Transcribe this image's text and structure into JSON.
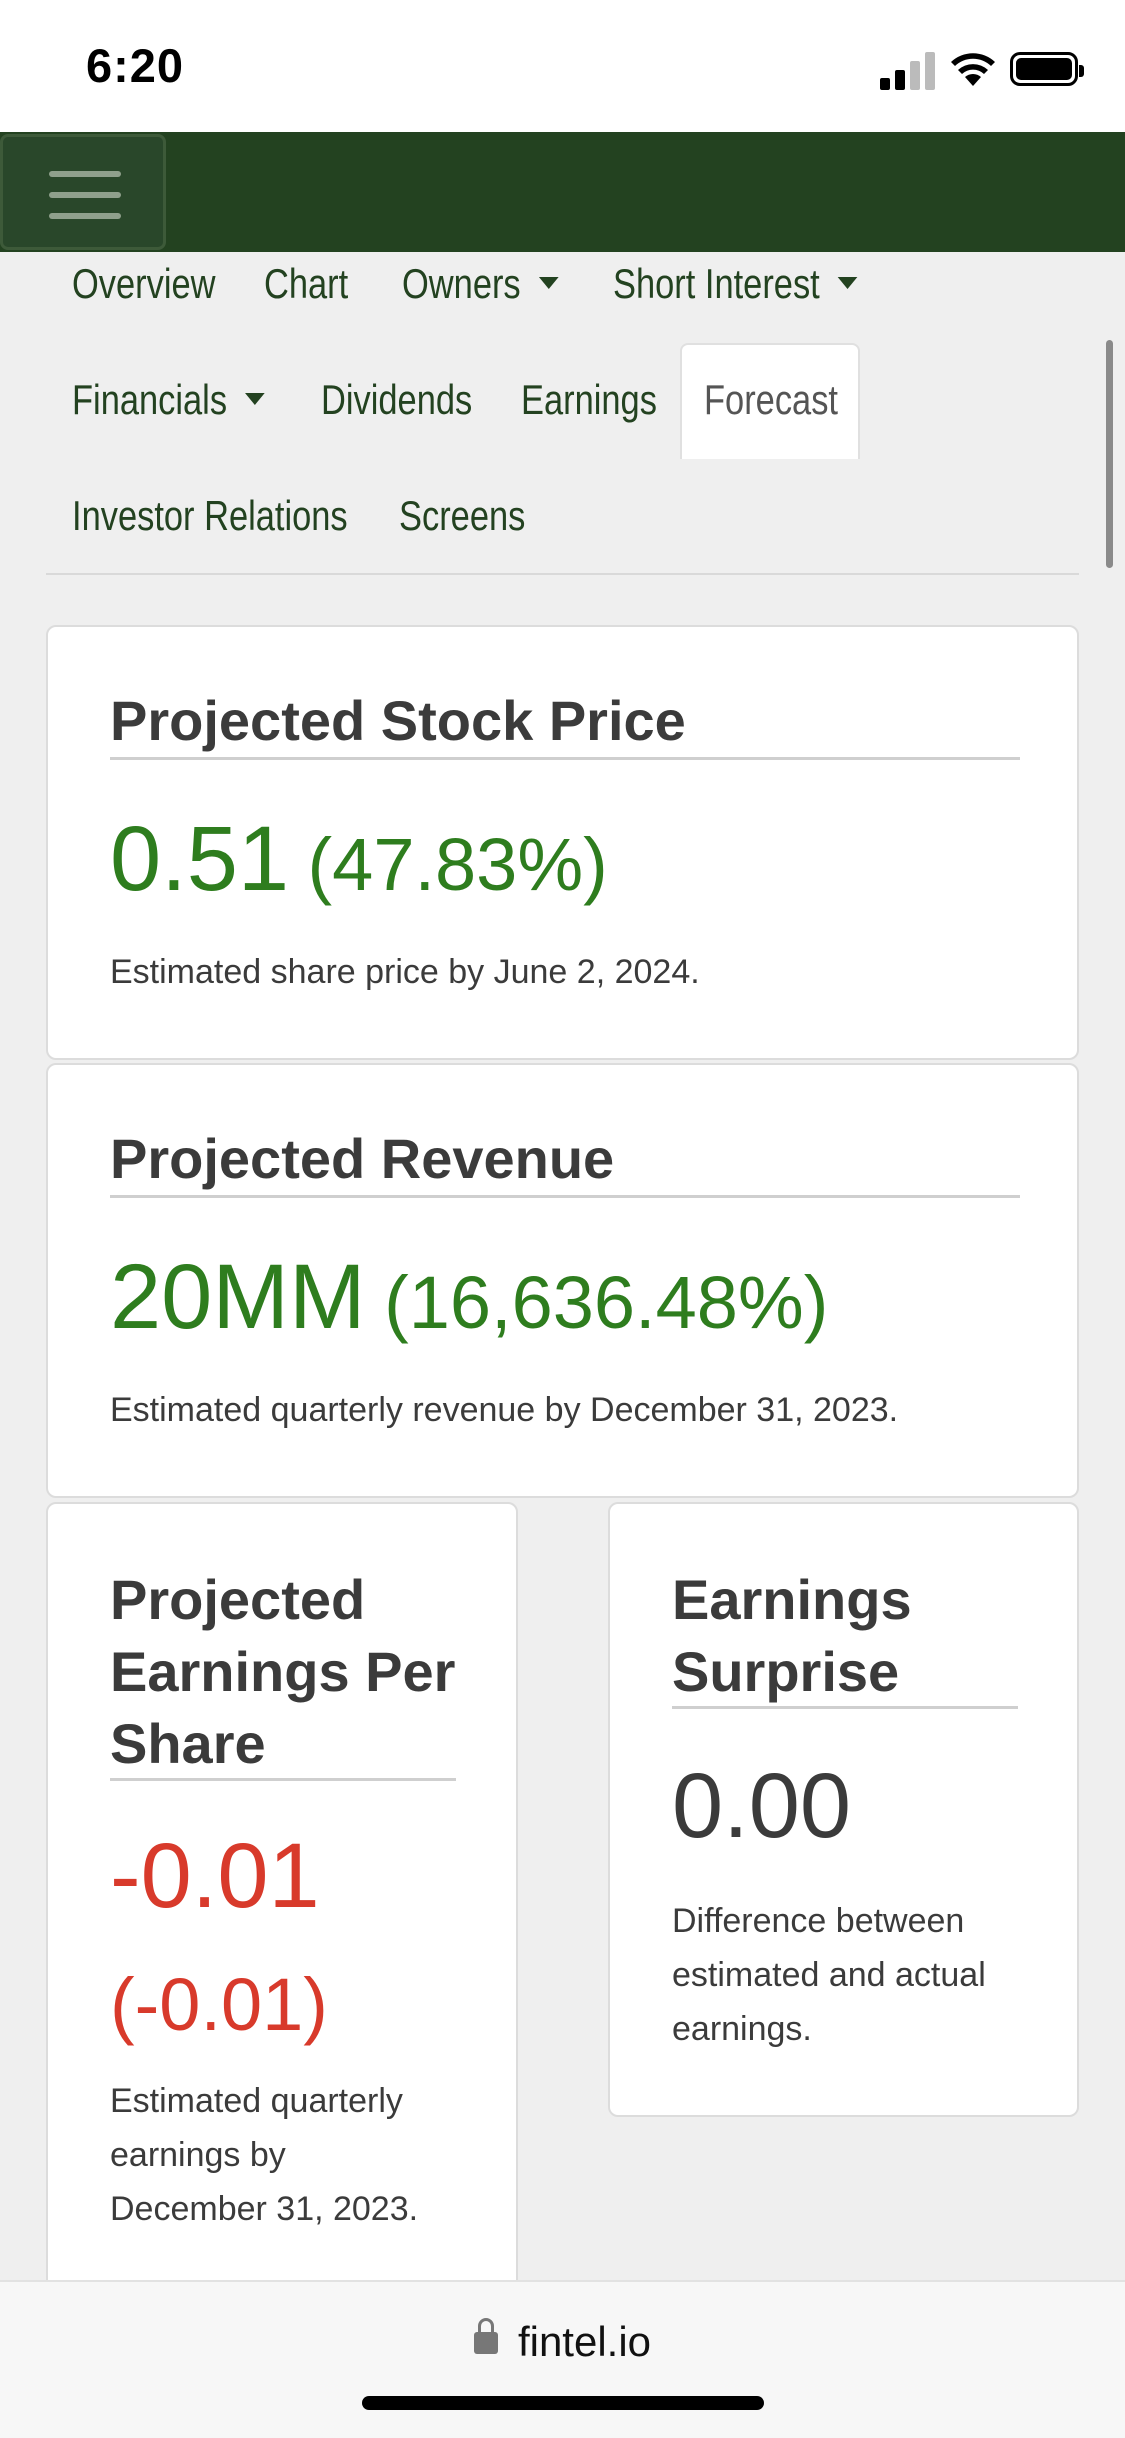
{
  "status_bar": {
    "time": "6:20"
  },
  "nav": {
    "overview": "Overview",
    "chart": "Chart",
    "owners": "Owners",
    "short_interest": "Short Interest",
    "financials": "Financials",
    "dividends": "Dividends",
    "earnings": "Earnings",
    "forecast": "Forecast",
    "investor_relations": "Investor Relations",
    "screens": "Screens",
    "active_tab": "Forecast"
  },
  "cards": {
    "stock_price": {
      "title": "Projected Stock Price",
      "value": "0.51",
      "change": "(47.83%)",
      "description": "Estimated share price by June 2, 2024."
    },
    "revenue": {
      "title": "Projected Revenue",
      "value": "20MM",
      "change": "(16,636.48%)",
      "description": "Estimated quarterly revenue by December 31, 2023."
    },
    "eps": {
      "title_line1": "Projected",
      "title_line2": "Earnings Per",
      "title_line3": "Share",
      "value": "-0.01",
      "change": "(-0.01)",
      "desc_line1": "Estimated quarterly",
      "desc_line2": "earnings by",
      "desc_line3": "December 31, 2023."
    },
    "surprise": {
      "title_line1": "Earnings",
      "title_line2": "Surprise",
      "value": "0.00",
      "desc_line1": "Difference between",
      "desc_line2": "estimated and actual",
      "desc_line3": "earnings."
    }
  },
  "colors": {
    "header_green": "#234220",
    "positive": "#2e7d1e",
    "negative": "#d83a2b"
  },
  "url_bar": {
    "domain": "fintel.io"
  }
}
